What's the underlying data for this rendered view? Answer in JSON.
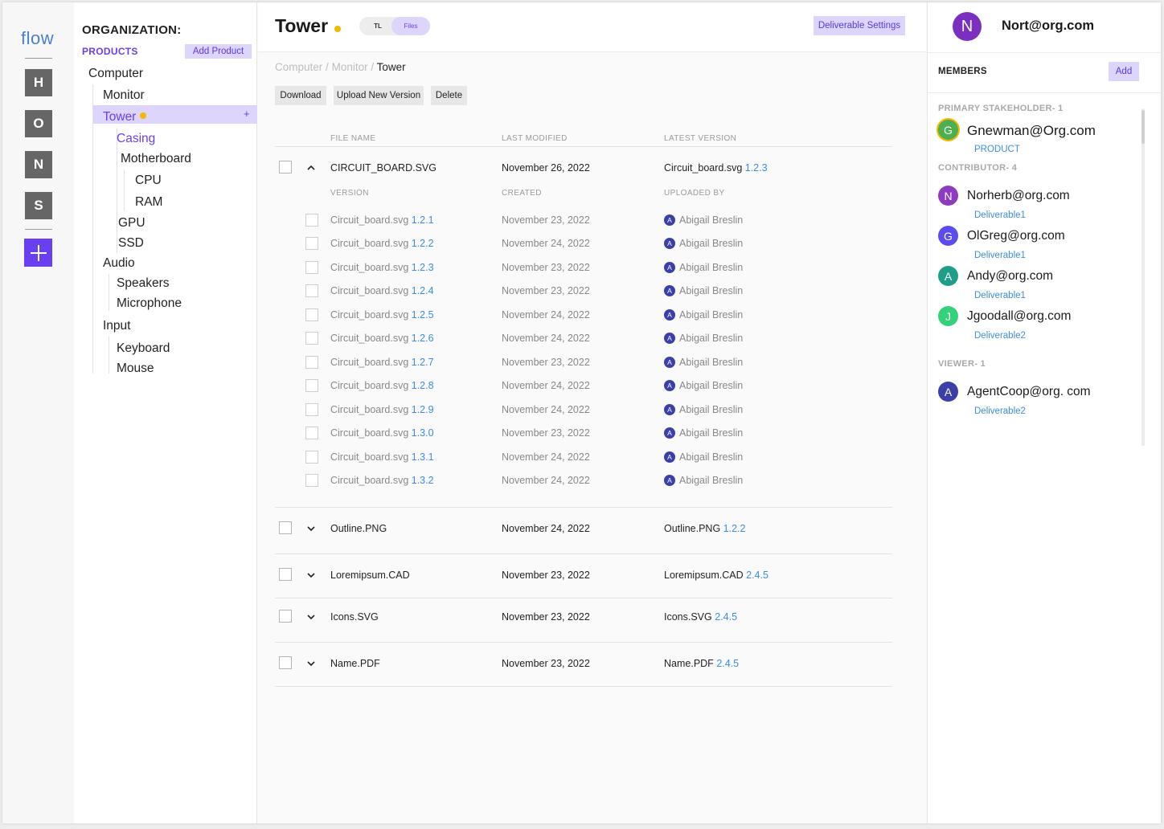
{
  "app": {
    "logo": "flow"
  },
  "rail": {
    "workspaces": [
      "H",
      "O",
      "N",
      "S"
    ]
  },
  "tree": {
    "org_title": "ORGANIZATION:",
    "products_label": "PRODUCTS",
    "add_product": "Add Product",
    "nodes": [
      "Computer",
      "Monitor",
      "Tower",
      "Casing",
      "Motherboard",
      "CPU",
      "RAM",
      "GPU",
      "SSD",
      "Audio",
      "Speakers",
      "Microphone",
      "Input",
      "Keyboard",
      "Mouse"
    ],
    "selected_add": "+"
  },
  "header": {
    "title": "Tower",
    "toggle": {
      "tl": "TL",
      "files": "Files"
    },
    "deliverable_settings": "Deliverable Settings"
  },
  "breadcrumb": {
    "p1": "Computer",
    "p2": "Monitor",
    "current": "Tower",
    "sep": "/"
  },
  "toolbar": {
    "download": "Download",
    "upload": "Upload New Version",
    "delete": "Delete"
  },
  "table": {
    "columns": {
      "file_name": "FILE NAME",
      "last_modified": "LAST MODIFIED",
      "latest_version": "LATEST VERSION"
    },
    "subcolumns": {
      "version": "VERSION",
      "created": "CREATED",
      "uploaded_by": "UPLOADED BY"
    },
    "expanded": {
      "name": "CIRCUIT_BOARD.SVG",
      "modified": "November 26, 2022",
      "latest_name": "Circuit_board.svg",
      "latest_ver": "1.2.3",
      "versions": [
        {
          "name": "Circuit_board.svg",
          "ver": "1.2.1",
          "created": "November 23, 2022",
          "by": "Abigail Breslin",
          "init": "A"
        },
        {
          "name": "Circuit_board.svg",
          "ver": "1.2.2",
          "created": "November 24, 2022",
          "by": "Abigail Breslin",
          "init": "A"
        },
        {
          "name": "Circuit_board.svg",
          "ver": "1.2.3",
          "created": "November 23, 2022",
          "by": "Abigail Breslin",
          "init": "A"
        },
        {
          "name": "Circuit_board.svg",
          "ver": "1.2.4",
          "created": "November 23, 2022",
          "by": "Abigail Breslin",
          "init": "A"
        },
        {
          "name": "Circuit_board.svg",
          "ver": "1.2.5",
          "created": "November 24, 2022",
          "by": "Abigail Breslin",
          "init": "A"
        },
        {
          "name": "Circuit_board.svg",
          "ver": "1.2.6",
          "created": "November 24, 2022",
          "by": "Abigail Breslin",
          "init": "A"
        },
        {
          "name": "Circuit_board.svg",
          "ver": "1.2.7",
          "created": "November 23, 2022",
          "by": "Abigail Breslin",
          "init": "A"
        },
        {
          "name": "Circuit_board.svg",
          "ver": "1.2.8",
          "created": "November 24, 2022",
          "by": "Abigail Breslin",
          "init": "A"
        },
        {
          "name": "Circuit_board.svg",
          "ver": "1.2.9",
          "created": "November 24, 2022",
          "by": "Abigail Breslin",
          "init": "A"
        },
        {
          "name": "Circuit_board.svg",
          "ver": "1.3.0",
          "created": "November 23, 2022",
          "by": "Abigail Breslin",
          "init": "A"
        },
        {
          "name": "Circuit_board.svg",
          "ver": "1.3.1",
          "created": "November 24, 2022",
          "by": "Abigail Breslin",
          "init": "A"
        },
        {
          "name": "Circuit_board.svg",
          "ver": "1.3.2",
          "created": "November 24, 2022",
          "by": "Abigail Breslin",
          "init": "A"
        }
      ]
    },
    "files": [
      {
        "name": "Outline.PNG",
        "modified": "November 24, 2022",
        "latest_name": "Outline.PNG",
        "latest_ver": "1.2.2"
      },
      {
        "name": "Loremipsum.CAD",
        "modified": "November 23, 2022",
        "latest_name": "Loremipsum.CAD",
        "latest_ver": "2.4.5"
      },
      {
        "name": "Icons.SVG",
        "modified": "November 23, 2022",
        "latest_name": "Icons.SVG",
        "latest_ver": "2.4.5"
      },
      {
        "name": "Name.PDF",
        "modified": "November 23, 2022",
        "latest_name": "Name.PDF",
        "latest_ver": "2.4.5"
      }
    ]
  },
  "right": {
    "user": {
      "initial": "N",
      "name": "Nort@org.com"
    },
    "members_label": "MEMBERS",
    "add": "Add",
    "groups": {
      "primary": "PRIMARY STAKEHOLDER- 1",
      "contributor": "CONTRIBUTOR- 4",
      "viewer": "VIEWER- 1"
    },
    "members": [
      {
        "initial": "G",
        "name": "Gnewman@Org.com",
        "role": "PRODUCT",
        "color": "#4caf50"
      },
      {
        "initial": "N",
        "name": "Norherb@org.com",
        "role": "Deliverable1",
        "color": "#8e3bc2"
      },
      {
        "initial": "G",
        "name": "OlGreg@org.com",
        "role": "Deliverable1",
        "color": "#5b4cf0"
      },
      {
        "initial": "A",
        "name": "Andy@org.com",
        "role": "Deliverable1",
        "color": "#1e9e8a"
      },
      {
        "initial": "J",
        "name": "Jgoodall@org.com",
        "role": "Deliverable2",
        "color": "#33d17a"
      },
      {
        "initial": "A",
        "name": "AgentCoop@org. com",
        "role": "Deliverable2",
        "color": "#3b3fa8"
      }
    ]
  }
}
